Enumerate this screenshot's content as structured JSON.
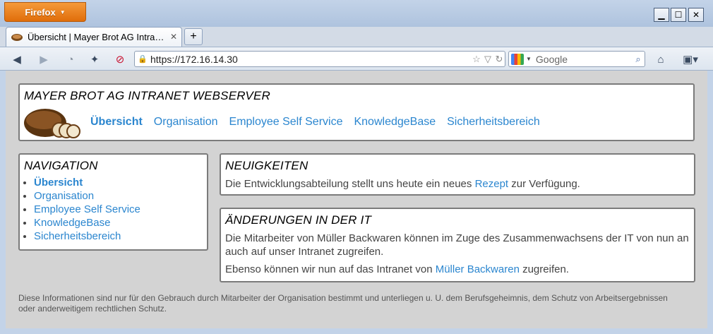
{
  "browser": {
    "app_button_label": "Firefox",
    "tab_title": "Übersicht | Mayer Brot AG Intra…",
    "url": "https://172.16.14.30",
    "search_placeholder": "Google"
  },
  "header": {
    "title": "MAYER BROT AG INTRANET WEBSERVER",
    "nav": [
      {
        "label": "Übersicht",
        "active": true
      },
      {
        "label": "Organisation",
        "active": false
      },
      {
        "label": "Employee Self Service",
        "active": false
      },
      {
        "label": "KnowledgeBase",
        "active": false
      },
      {
        "label": "Sicherheitsbereich",
        "active": false
      }
    ]
  },
  "navigation": {
    "title": "NAVIGATION",
    "items": [
      {
        "label": "Übersicht",
        "active": true
      },
      {
        "label": "Organisation",
        "active": false
      },
      {
        "label": "Employee Self Service",
        "active": false
      },
      {
        "label": "KnowledgeBase",
        "active": false
      },
      {
        "label": "Sicherheitsbereich",
        "active": false
      }
    ]
  },
  "news": {
    "title": "NEUIGKEITEN",
    "text_before": "Die Entwicklungsabteilung stellt uns heute ein neues ",
    "link": "Rezept",
    "text_after": " zur Verfügung."
  },
  "it_changes": {
    "title": "ÄNDERUNGEN IN DER IT",
    "para1": "Die Mitarbeiter von Müller Backwaren können im Zuge des Zusammenwachsens der IT von nun an auch auf unser Intranet zugreifen.",
    "para2_before": "Ebenso können wir nun auf das Intranet von ",
    "para2_link": "Müller Backwaren",
    "para2_after": " zugreifen."
  },
  "footer": {
    "text": "Diese Informationen sind nur für den Gebrauch durch Mitarbeiter der Organisation bestimmt und unterliegen u. U. dem Berufsgeheimnis, dem Schutz von Arbeitsergebnissen oder anderweitigem rechtlichen Schutz."
  },
  "colors": {
    "link": "#2b86cf",
    "page_bg": "#d3d3d3",
    "firefox_orange": "#e06d0a"
  }
}
